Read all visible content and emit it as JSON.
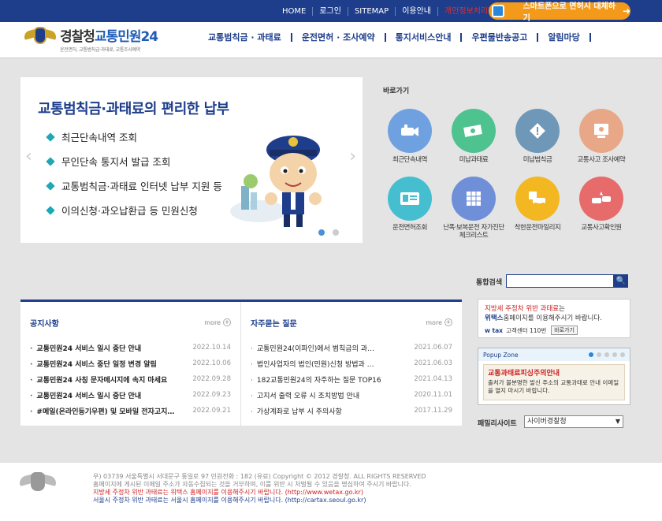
{
  "topbar": {
    "links": [
      "HOME",
      "로그인",
      "SITEMAP",
      "이용안내"
    ],
    "red_link": "개인정보처리방침",
    "smartphone_banner": "스마트폰으로 면허시 대체하기"
  },
  "header": {
    "logo_title_a": "경찰청",
    "logo_title_b": "교통민원24",
    "logo_sub": "운전면허, 교통범칙금·과태료, 교통조사예약",
    "nav": [
      "교통범칙금 · 과태료",
      "운전면허 · 조사예약",
      "통지서비스안내",
      "우편물반송공고",
      "알림마당"
    ]
  },
  "slider": {
    "title": "교통범칙금·과태료의 편리한 납부",
    "items": [
      "최근단속내역 조회",
      "무인단속 통지서 발급 조회",
      "교통범칙금·과태료 인터넷 납부 지원 등",
      "이의신청·과오납환급 등 민원신청"
    ]
  },
  "quick": {
    "title": "바로가기",
    "items": [
      {
        "label": "최근단속내역",
        "color": "#6fa1e0"
      },
      {
        "label": "미납과태료",
        "color": "#4fc38f"
      },
      {
        "label": "미납범칙금",
        "color": "#6f98b8"
      },
      {
        "label": "교통사고 조사예약",
        "color": "#e8a888"
      },
      {
        "label": "운전면허조회",
        "color": "#45bfcf"
      },
      {
        "label": "난폭·보복운전 자가진단 체크리스트",
        "color": "#6f8fd8"
      },
      {
        "label": "착한운전마일리지",
        "color": "#f3b722"
      },
      {
        "label": "교통사고확인원",
        "color": "#e86b6b"
      }
    ]
  },
  "search": {
    "label": "통합검색",
    "button": "🔍"
  },
  "notice": {
    "title": "공지사항",
    "more": "more",
    "rows": [
      {
        "title": "교통민원24 서비스 일시 중단 안내",
        "date": "2022.10.14"
      },
      {
        "title": "교통민원24 서비스 중단 일정 변경 알림",
        "date": "2022.10.06"
      },
      {
        "title": "교통민원24 사칭 문자메시지에 속지 마세요",
        "date": "2022.09.28"
      },
      {
        "title": "교통민원24 서비스 일시 중단 안내",
        "date": "2022.09.23"
      },
      {
        "title": "#메일(온라인등기우편) 및 모바일 전자고지 안내",
        "date": "2022.09.21"
      }
    ]
  },
  "faq": {
    "title": "자주묻는 질문",
    "more": "more",
    "rows": [
      {
        "title": "교통민원24(이파인)에서 범칙금의 과…",
        "date": "2021.06.07"
      },
      {
        "title": "법인사업자의 법인(민원)신청 방법과 …",
        "date": "2021.06.03"
      },
      {
        "title": "182교통민원24의 자주하는 질문 TOP16",
        "date": "2021.04.13"
      },
      {
        "title": "고지서 출력 오류 시 조치방법 안내",
        "date": "2020.11.01"
      },
      {
        "title": "가상계좌로 납부 시 주의사항",
        "date": "2017.11.29"
      }
    ]
  },
  "ad": {
    "line1_red": "지방세 주정차 위반 과태료",
    "line1_rest": "는",
    "line2_bold": "위택스",
    "line2_rest": "홈페이지를 이용해주시기 바랍니다.",
    "line3_brand": "w tax",
    "line3_text": "고객센터 110번",
    "line3_btn": "바로가기"
  },
  "popup": {
    "title": "Popup Zone",
    "heading": "교통과태료피싱주의안내",
    "text": "출처가 불분명한 발신 주소의 교통과태료 안내 이메일을 열지 마시기 바랍니다."
  },
  "family": {
    "label": "패밀리사이트",
    "selected": "사이버경찰청"
  },
  "footer": {
    "line1": "우) 03739 서울특별시 서대문구 통일로 97  민원전화 : 182 (유료)        Copyright © 2012 경찰청. ALL RIGHTS RESERVED",
    "line2": "홈페이지에 게시된 이메일 주소가 자동수집되는 것을 거부하며, 이를 위반 시 처벌될 수 있음을 명심하여 주시기 바랍니다.",
    "line3": "지방세 주정차 위반 과태료는 위택스 홈페이지를 이용해주시기 바랍니다. (http://www.wetax.go.kr)",
    "line4": "서울시 주정차 위반 과태료는 서울시 홈페이지를 이용해주시기 바랍니다. (http://cartax.seoul.go.kr)"
  }
}
